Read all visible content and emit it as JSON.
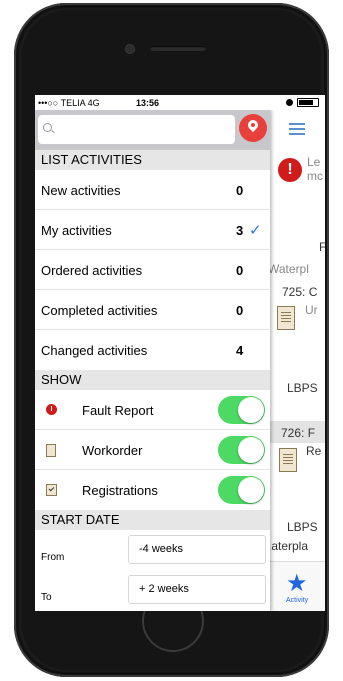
{
  "status_bar": {
    "carrier": "•••○○ TELIA  4G",
    "time": "13:56"
  },
  "search": {
    "placeholder": ""
  },
  "list_activities": {
    "header": "LIST ACTIVITIES",
    "items": [
      {
        "label": "New activities",
        "count": "0",
        "checked": false
      },
      {
        "label": "My activities",
        "count": "3",
        "checked": true
      },
      {
        "label": "Ordered activities",
        "count": "0",
        "checked": false
      },
      {
        "label": "Completed activities",
        "count": "0",
        "checked": false
      },
      {
        "label": "Changed activities",
        "count": "4",
        "checked": false
      }
    ]
  },
  "show": {
    "header": "SHOW",
    "items": [
      {
        "label": "Fault Report",
        "icon": "fault-report-icon",
        "on": true
      },
      {
        "label": "Workorder",
        "icon": "workorder-icon",
        "on": true
      },
      {
        "label": "Registrations",
        "icon": "registrations-icon",
        "on": true
      }
    ]
  },
  "start_date": {
    "header": "START DATE",
    "from_label": "From",
    "from_value": "-4 weeks",
    "to_label": "To",
    "to_value": "+ 2 weeks"
  },
  "background": {
    "partial_texts": [
      "Le",
      "mc",
      "F",
      "Waterpl",
      "725: C",
      "Ur",
      "LBPS",
      "726: F",
      "Re",
      "LBPS",
      ".aterpla"
    ],
    "nav_label": "Activity"
  },
  "colors": {
    "toggle_on": "#4cd964",
    "check": "#2677e0",
    "fault": "#d11a1a",
    "accent": "#2266dd"
  }
}
